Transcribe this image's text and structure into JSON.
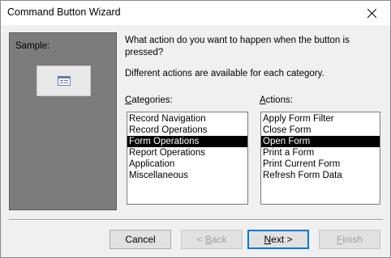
{
  "window": {
    "title": "Command Button Wizard"
  },
  "sample": {
    "label": "Sample:"
  },
  "prompt": {
    "question": "What action do you want to happen when the button is pressed?",
    "hint": "Different actions are available for each category."
  },
  "categories": {
    "label_accel": "C",
    "label_rest": "ategories:",
    "items": [
      "Record Navigation",
      "Record Operations",
      "Form Operations",
      "Report Operations",
      "Application",
      "Miscellaneous"
    ],
    "selected": "Form Operations"
  },
  "actions": {
    "label_accel": "A",
    "label_rest": "ctions:",
    "items": [
      "Apply Form Filter",
      "Close Form",
      "Open Form",
      "Print a Form",
      "Print Current Form",
      "Refresh Form Data"
    ],
    "selected": "Open Form"
  },
  "buttons": {
    "cancel": "Cancel",
    "back_pre": "< ",
    "back_accel": "B",
    "back_rest": "ack",
    "next_accel": "N",
    "next_rest": "ext >",
    "finish_accel": "F",
    "finish_rest": "inish"
  }
}
